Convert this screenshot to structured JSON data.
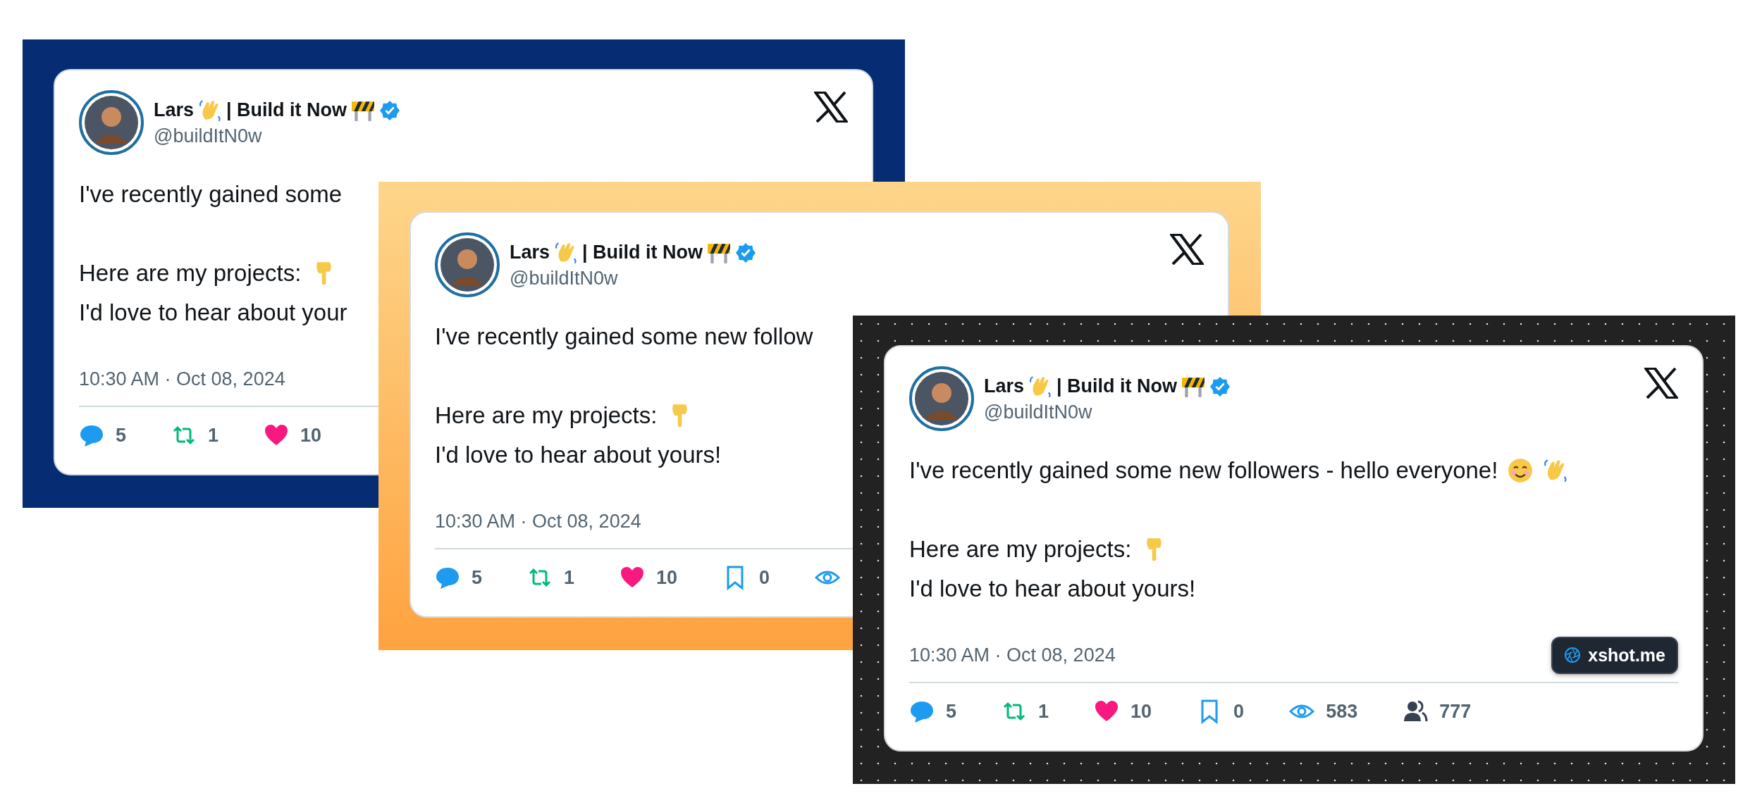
{
  "cards": [
    {
      "kind": "navy",
      "author": {
        "name_parts": [
          {
            "kind": "text",
            "text": "Lars"
          },
          {
            "kind": "wave"
          },
          {
            "kind": "text",
            "text": "| Build it Now"
          },
          {
            "kind": "barrier"
          }
        ],
        "handle": "@buildItN0w",
        "verified": true
      },
      "paragraphs": [
        [
          [
            {
              "kind": "text",
              "text": "I've recently gained some"
            }
          ]
        ],
        [
          [
            {
              "kind": "text",
              "text": "Here are my projects:"
            },
            {
              "kind": "point-down"
            }
          ],
          [
            {
              "kind": "text",
              "text": "I'd love to hear about your"
            }
          ]
        ]
      ],
      "timestamp": "10:30 AM · Oct 08, 2024",
      "stats": [
        {
          "kind": "reply",
          "count": "5"
        },
        {
          "kind": "repost",
          "count": "1"
        },
        {
          "kind": "like",
          "count": "10"
        }
      ]
    },
    {
      "kind": "orange",
      "author": {
        "name_parts": [
          {
            "kind": "text",
            "text": "Lars"
          },
          {
            "kind": "wave"
          },
          {
            "kind": "text",
            "text": "| Build it Now"
          },
          {
            "kind": "barrier"
          }
        ],
        "handle": "@buildItN0w",
        "verified": true
      },
      "paragraphs": [
        [
          [
            {
              "kind": "text",
              "text": "I've recently gained some new follow"
            }
          ]
        ],
        [
          [
            {
              "kind": "text",
              "text": "Here are my projects:"
            },
            {
              "kind": "point-down"
            }
          ],
          [
            {
              "kind": "text",
              "text": "I'd love to hear about yours!"
            }
          ]
        ]
      ],
      "timestamp": "10:30 AM · Oct 08, 2024",
      "stats": [
        {
          "kind": "reply",
          "count": "5"
        },
        {
          "kind": "repost",
          "count": "1"
        },
        {
          "kind": "like",
          "count": "10"
        },
        {
          "kind": "bookmark",
          "count": "0"
        },
        {
          "kind": "views"
        }
      ]
    },
    {
      "kind": "dots",
      "author": {
        "name_parts": [
          {
            "kind": "text",
            "text": "Lars"
          },
          {
            "kind": "wave"
          },
          {
            "kind": "text",
            "text": "| Build it Now"
          },
          {
            "kind": "barrier"
          }
        ],
        "handle": "@buildItN0w",
        "verified": true
      },
      "paragraphs": [
        [
          [
            {
              "kind": "text",
              "text": "I've recently gained some new followers - hello everyone!"
            },
            {
              "kind": "smile"
            },
            {
              "kind": "wave"
            }
          ]
        ],
        [
          [
            {
              "kind": "text",
              "text": "Here are my projects:"
            },
            {
              "kind": "point-down"
            }
          ],
          [
            {
              "kind": "text",
              "text": "I'd love to hear about yours!"
            }
          ]
        ]
      ],
      "timestamp": "10:30 AM · Oct 08, 2024",
      "badge": "xshot.me",
      "stats": [
        {
          "kind": "reply",
          "count": "5"
        },
        {
          "kind": "repost",
          "count": "1"
        },
        {
          "kind": "like",
          "count": "10"
        },
        {
          "kind": "bookmark",
          "count": "0"
        },
        {
          "kind": "views",
          "count": "583"
        },
        {
          "kind": "followers",
          "count": "777"
        }
      ]
    }
  ]
}
